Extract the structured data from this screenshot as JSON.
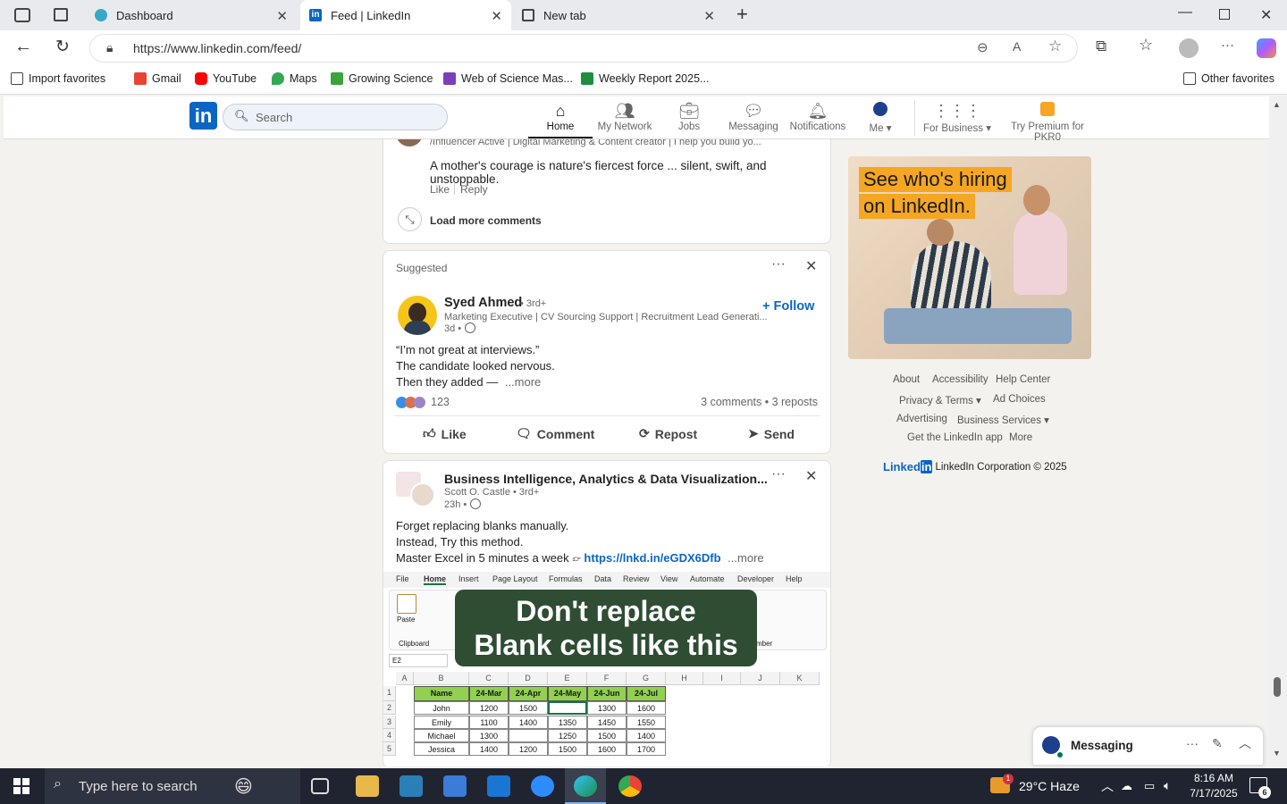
{
  "browser": {
    "tabs": [
      {
        "label": "Dashboard"
      },
      {
        "label": "Feed | LinkedIn"
      },
      {
        "label": "New tab"
      }
    ],
    "url": "https://www.linkedin.com/feed/",
    "favorites": [
      "Import favorites",
      "Gmail",
      "YouTube",
      "Maps",
      "Growing Science",
      "Web of Science Mas...",
      "Weekly Report 2025..."
    ],
    "other_favorites": "Other favorites"
  },
  "linkedin_nav": {
    "search_placeholder": "Search",
    "items": [
      {
        "label": "Home",
        "icon": "home-icon"
      },
      {
        "label": "My Network",
        "icon": "network-icon"
      },
      {
        "label": "Jobs",
        "icon": "briefcase-icon"
      },
      {
        "label": "Messaging",
        "icon": "chat-icon"
      },
      {
        "label": "Notifications",
        "icon": "bell-icon"
      },
      {
        "label": "Me",
        "icon": "avatar-icon"
      },
      {
        "label": "For Business",
        "icon": "grid-icon"
      },
      {
        "label": "Try Premium for PKR0",
        "icon": "premium-icon"
      }
    ]
  },
  "comment_card": {
    "headline": "/Influencer Active | Digital Marketing & Content creator | I help you build yo...",
    "text": "A mother's courage is nature's fiercest force ... silent, swift, and unstoppable.",
    "like": "Like",
    "reply": "Reply",
    "load_more": "Load more comments"
  },
  "post1": {
    "label": "Suggested",
    "author": "Syed Ahmed",
    "degree": "• 3rd+",
    "headline": "Marketing Executive | CV Sourcing Support | Recruitment Lead Generati...",
    "time": "3d •",
    "follow": "+ Follow",
    "lines": [
      "“I’m not great at interviews.”",
      "The candidate looked nervous.",
      "Then they added —"
    ],
    "more": "...more",
    "reactions": "123",
    "stats": "3 comments • 3 reposts",
    "actions": [
      "Like",
      "Comment",
      "Repost",
      "Send"
    ]
  },
  "post2": {
    "title": "Business Intelligence, Analytics & Data Visualization...",
    "author": "Scott O. Castle • 3rd+",
    "time": "23h •",
    "lines": [
      "Forget replacing blanks manually.",
      "Instead, Try this method."
    ],
    "line3": "Master Excel in 5 minutes a week",
    "link": "https://lnkd.in/eGDX6Dfb",
    "more": "...more",
    "image_banner": [
      "Don't replace",
      "Blank cells like this"
    ],
    "excel_tabs": [
      "File",
      "Home",
      "Insert",
      "Page Layout",
      "Formulas",
      "Data",
      "Review",
      "View",
      "Automate",
      "Developer",
      "Help"
    ],
    "excel_cellref": "E2",
    "excel_cols": [
      "A",
      "B",
      "C",
      "D",
      "E",
      "F",
      "G",
      "H",
      "I",
      "J",
      "K"
    ],
    "excel_header": [
      "Name",
      "24-Mar",
      "24-Apr",
      "24-May",
      "24-Jun",
      "24-Jul"
    ],
    "excel_rows": [
      [
        "John",
        "1200",
        "1500",
        "",
        "1300",
        "1600"
      ],
      [
        "Emily",
        "1100",
        "1400",
        "1350",
        "1450",
        "1550"
      ],
      [
        "Michael",
        "1300",
        "",
        "1250",
        "1500",
        "1400"
      ],
      [
        "Jessica",
        "1400",
        "1200",
        "1500",
        "1600",
        "1700"
      ]
    ],
    "excel_ribbon": [
      "Paste",
      "Clipboard",
      "mber"
    ]
  },
  "ad": {
    "line1": "See who's hiring",
    "line2": "on LinkedIn."
  },
  "footer": {
    "links": [
      "About",
      "Accessibility",
      "Help Center",
      "Privacy & Terms ▾",
      "Ad Choices",
      "Advertising",
      "Business Services ▾",
      "Get the LinkedIn app",
      "More"
    ],
    "brand": "LinkedIn Corporation © 2025"
  },
  "messaging": {
    "label": "Messaging"
  },
  "taskbar": {
    "search_placeholder": "Type here to search",
    "weather": "29°C  Haze",
    "time": "8:16 AM",
    "date": "7/17/2025",
    "notif_count": "6",
    "weather_badge": "1"
  },
  "colors": {
    "linkedin_blue": "#0a66c2",
    "excel_green": "#2e4d33",
    "header_green": "#92d050"
  }
}
